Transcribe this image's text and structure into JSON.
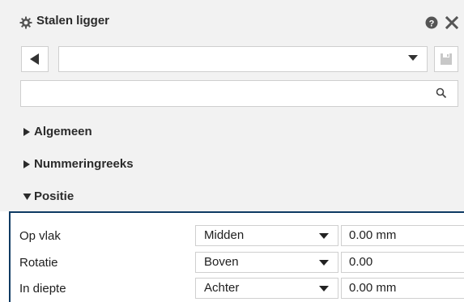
{
  "window": {
    "title": "Stalen ligger",
    "title_icon": "gear-icon",
    "help_icon": "help-icon",
    "close_icon": "close-icon"
  },
  "toolbar": {
    "back_icon": "triangle-left-icon",
    "preset_value": "",
    "preset_icon": "chevron-down-icon",
    "save_icon": "save-icon"
  },
  "search": {
    "value": "",
    "placeholder": "",
    "icon": "search-icon"
  },
  "sections": [
    {
      "label": "Algemeen",
      "expanded": false
    },
    {
      "label": "Nummeringreeks",
      "expanded": false
    },
    {
      "label": "Positie",
      "expanded": true
    }
  ],
  "positie_rows": [
    {
      "label": "Op vlak",
      "option": "Midden",
      "value": "0.00 mm"
    },
    {
      "label": "Rotatie",
      "option": "Boven",
      "value": "0.00"
    },
    {
      "label": "In diepte",
      "option": "Achter",
      "value": "0.00 mm"
    }
  ],
  "colors": {
    "panel_bg": "#f2f2f2",
    "focus_border": "#0e3a63",
    "icon": "#555555",
    "icon_disabled": "#c8c8c8"
  }
}
